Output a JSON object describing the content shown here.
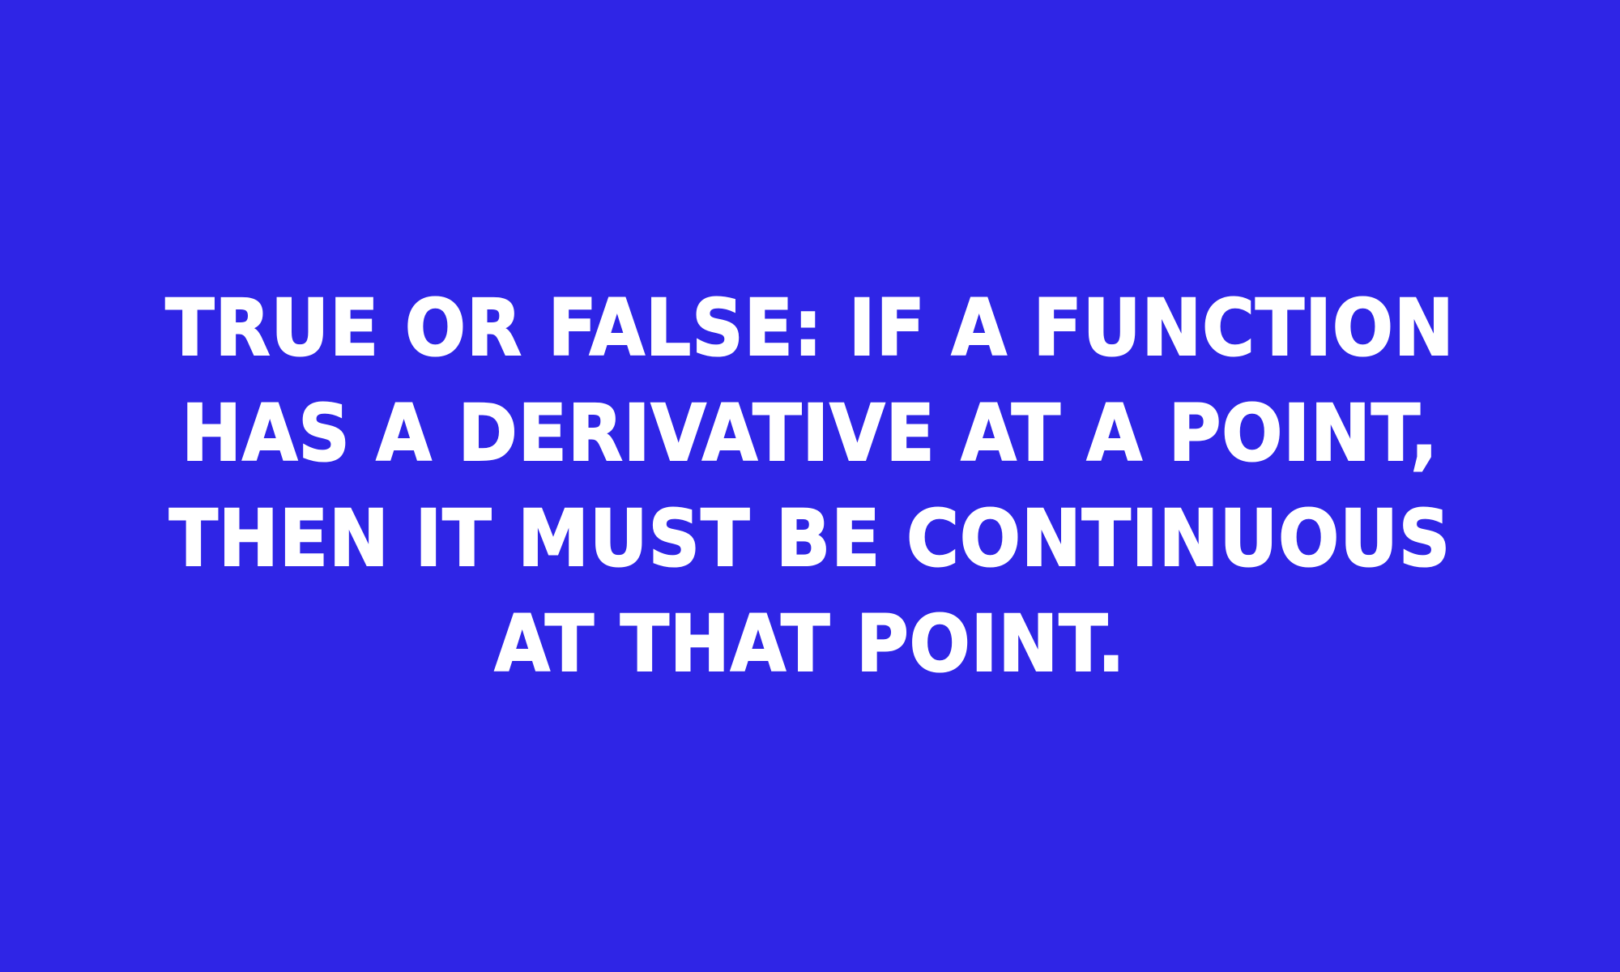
{
  "question": {
    "text": "TRUE OR FALSE: IF A FUNCTION HAS A DERIVATIVE AT A POINT, THEN IT MUST BE CONTINUOUS AT THAT POINT."
  },
  "colors": {
    "background": "#2f25e6",
    "text": "#ffffff"
  }
}
